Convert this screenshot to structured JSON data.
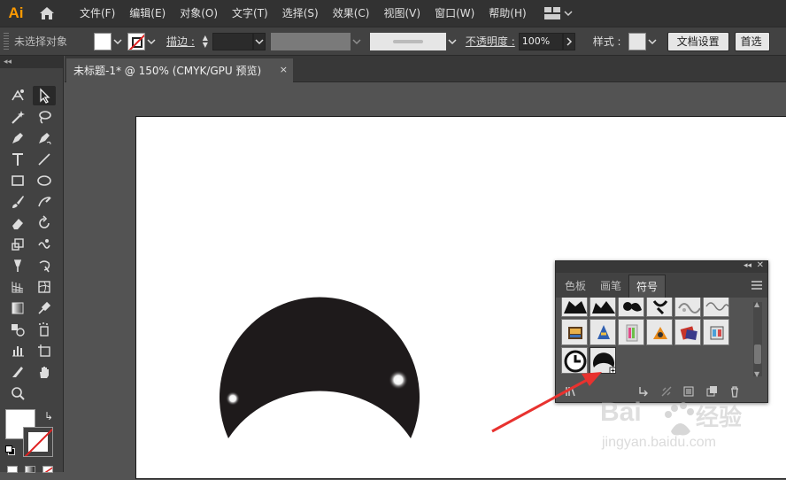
{
  "menubar": {
    "logo": "Ai",
    "items": [
      "文件(F)",
      "编辑(E)",
      "对象(O)",
      "文字(T)",
      "选择(S)",
      "效果(C)",
      "视图(V)",
      "窗口(W)",
      "帮助(H)"
    ]
  },
  "controlbar": {
    "selection_status": "未选择对象",
    "stroke_label": "描边 :",
    "opacity_label": "不透明度 :",
    "opacity_value": "100%",
    "style_label": "样式 :",
    "doc_settings_button": "文档设置",
    "preferences_button": "首选"
  },
  "document_tab": {
    "title": "未标题-1* @ 150% (CMYK/GPU 预览)",
    "close": "×"
  },
  "symbols_panel": {
    "tabs": [
      "色板",
      "画笔",
      "符号"
    ],
    "active_tab": "符号"
  },
  "watermark": {
    "brand": "Bai",
    "brand_cn": "经验",
    "url": "jingyan.baidu.com"
  },
  "colors": {
    "accent_logo": "#ff9a00",
    "arrow": "#e8322f",
    "shape_fill": "#1e1a1b"
  }
}
